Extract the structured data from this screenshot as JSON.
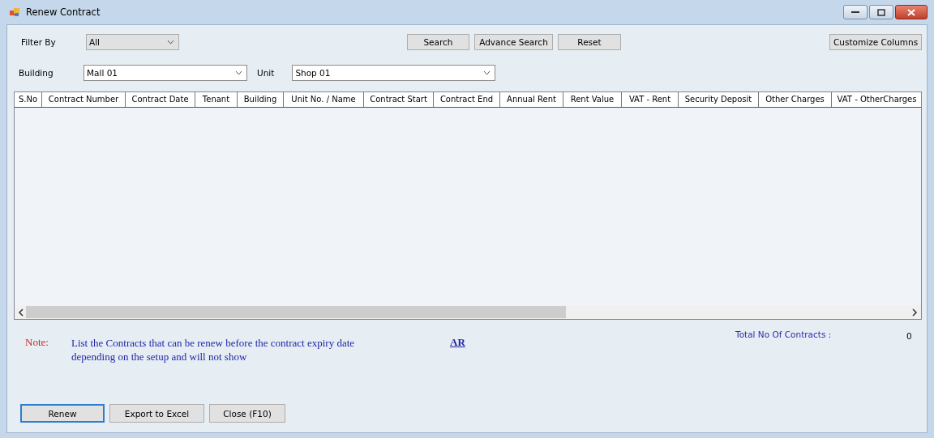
{
  "window": {
    "title": "Renew Contract"
  },
  "filter": {
    "label": "Filter By",
    "value": "All"
  },
  "search_buttons": [
    "Search",
    "Advance Search",
    "Reset"
  ],
  "customize_button": "Customize Columns",
  "building": {
    "label": "Building",
    "value": "Mall 01"
  },
  "unit": {
    "label": "Unit",
    "value": "Shop 01"
  },
  "table": {
    "columns": [
      "S.No",
      "Contract Number",
      "Contract Date",
      "Tenant",
      "Building",
      "Unit No. / Name",
      "Contract Start",
      "Contract End",
      "Annual Rent",
      "Rent Value",
      "VAT - Rent",
      "Security Deposit",
      "Other Charges",
      "VAT - OtherCharges"
    ]
  },
  "note": {
    "label": "Note:",
    "text": "List the Contracts that can be renew before the contract expiry date depending on the setup and will not show",
    "link": "AR"
  },
  "total": {
    "label": "Total No Of Contracts :",
    "value": "0"
  },
  "buttons": [
    {
      "label": "Renew",
      "default": true
    },
    {
      "label": "Export to Excel",
      "default": false
    },
    {
      "label": "Close (F10)",
      "default": false
    }
  ]
}
